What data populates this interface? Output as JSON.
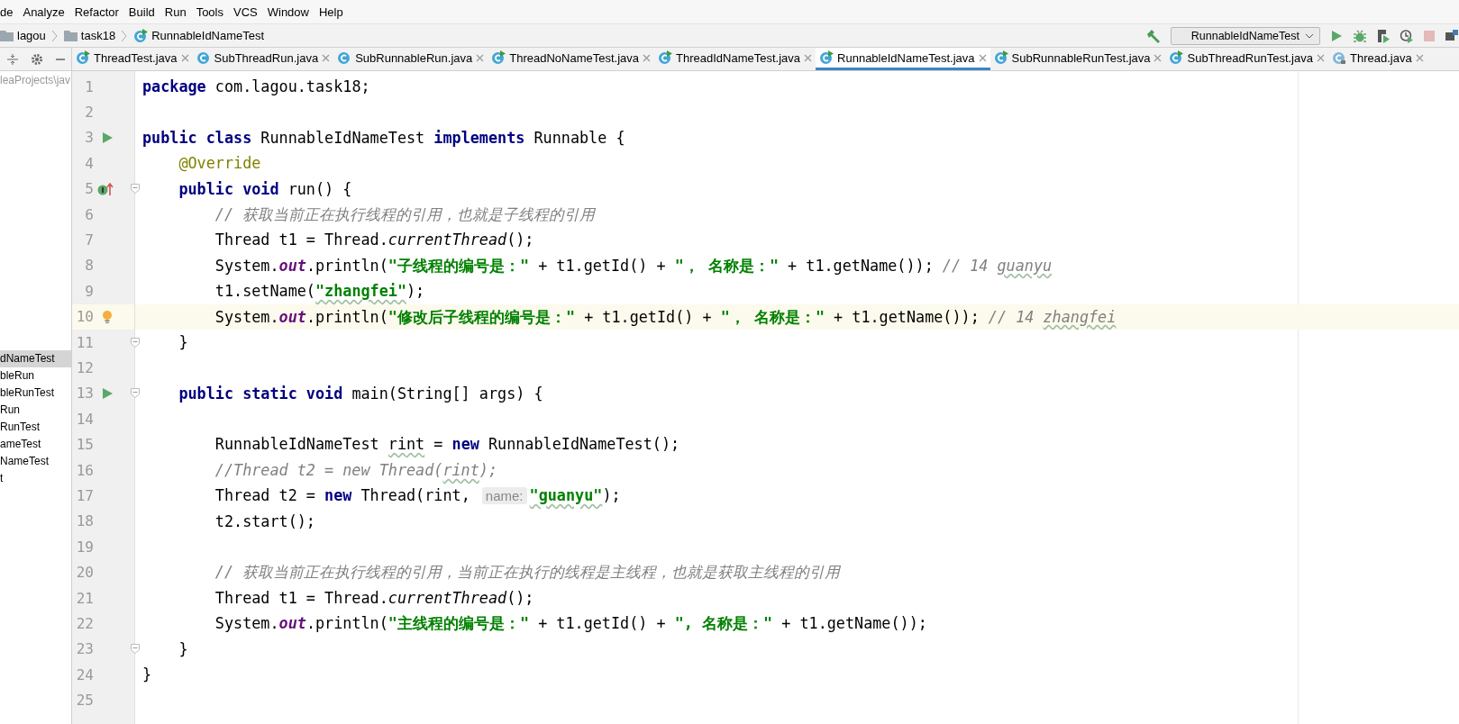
{
  "menu": [
    "de",
    "Analyze",
    "Refactor",
    "Build",
    "Run",
    "Tools",
    "VCS",
    "Window",
    "Help"
  ],
  "breadcrumbs": [
    {
      "label": "lagou",
      "kind": "folder"
    },
    {
      "label": "task18",
      "kind": "folder"
    },
    {
      "label": "RunnableIdNameTest",
      "kind": "class"
    }
  ],
  "toolbar": {
    "run_config": "RunnableIdNameTest",
    "actions": [
      {
        "kind": "build",
        "disabled": false
      },
      {
        "kind": "run",
        "disabled": false
      },
      {
        "kind": "debug",
        "disabled": false
      },
      {
        "kind": "coverage",
        "disabled": false
      },
      {
        "kind": "profile",
        "disabled": false
      },
      {
        "kind": "stop",
        "disabled": true
      },
      {
        "kind": "structure",
        "disabled": false
      }
    ]
  },
  "tabs": [
    {
      "label": "ThreadTest.java",
      "kind": "runnable",
      "selected": false
    },
    {
      "label": "SubThreadRun.java",
      "kind": "class",
      "selected": false
    },
    {
      "label": "SubRunnableRun.java",
      "kind": "class",
      "selected": false
    },
    {
      "label": "ThreadNoNameTest.java",
      "kind": "runnable",
      "selected": false
    },
    {
      "label": "ThreadIdNameTest.java",
      "kind": "runnable",
      "selected": false
    },
    {
      "label": "RunnableIdNameTest.java",
      "kind": "runnable",
      "selected": true
    },
    {
      "label": "SubRunnableRunTest.java",
      "kind": "runnable",
      "selected": false
    },
    {
      "label": "SubThreadRunTest.java",
      "kind": "runnable",
      "selected": false
    },
    {
      "label": "Thread.java",
      "kind": "library",
      "selected": false
    }
  ],
  "project": {
    "path": "leaProjects\\jav",
    "items": [
      {
        "label": "dNameTest",
        "selected": true
      },
      {
        "label": "bleRun",
        "selected": false
      },
      {
        "label": "bleRunTest",
        "selected": false
      },
      {
        "label": "Run",
        "selected": false
      },
      {
        "label": "RunTest",
        "selected": false
      },
      {
        "label": "ameTest",
        "selected": false
      },
      {
        "label": "NameTest",
        "selected": false
      },
      {
        "label": "t",
        "selected": false
      }
    ]
  },
  "editor": {
    "lines": [
      {
        "number": "1",
        "current": false,
        "fold": false,
        "tokens": [
          {
            "kind": "kw",
            "t": "package"
          },
          {
            "kind": "id",
            "t": " com.lagou.task18;"
          }
        ]
      },
      {
        "number": "2",
        "current": false,
        "fold": false
      },
      {
        "number": "3",
        "current": false,
        "fold": false,
        "marker": {
          "kind": "run"
        },
        "tokens": [
          {
            "kind": "kw",
            "t": "public class"
          },
          {
            "kind": "id",
            "t": " RunnableIdNameTest "
          },
          {
            "kind": "kw",
            "t": "implements"
          },
          {
            "kind": "id",
            "t": " Runnable {"
          }
        ]
      },
      {
        "number": "4",
        "current": false,
        "fold": false,
        "tokens": [
          {
            "kind": "ann",
            "t": "    @Override"
          }
        ]
      },
      {
        "number": "5",
        "current": false,
        "fold": true,
        "marker": {
          "kind": "implements"
        },
        "tokens": [
          {
            "kind": "kw",
            "t": "    public void"
          },
          {
            "kind": "id",
            "t": " run() {"
          }
        ]
      },
      {
        "number": "6",
        "current": false,
        "fold": false,
        "tokens": [
          {
            "kind": "cmt",
            "t": "        // 获取当前正在执行线程的引用，也就是子线程的引用"
          }
        ]
      },
      {
        "number": "7",
        "current": false,
        "fold": false,
        "tokens": [
          {
            "kind": "id",
            "t": "        Thread t1 = Thread."
          },
          {
            "kind": "smethod",
            "t": "currentThread"
          },
          {
            "kind": "id",
            "t": "();"
          }
        ]
      },
      {
        "number": "8",
        "current": false,
        "fold": false,
        "tokens": [
          {
            "kind": "id",
            "t": "        System."
          },
          {
            "kind": "sfield",
            "t": "out"
          },
          {
            "kind": "id",
            "t": ".println("
          },
          {
            "kind": "str",
            "t": "\"子线程的编号是：\""
          },
          {
            "kind": "id",
            "t": " + t1.getId() + "
          },
          {
            "kind": "str",
            "t": "\"， 名称是：\""
          },
          {
            "kind": "id",
            "t": " + t1.getName()); "
          },
          {
            "kind": "cmt",
            "t": "// 14 "
          },
          {
            "kind": "cmt",
            "t": "guanyu",
            "wavy": true
          }
        ]
      },
      {
        "number": "9",
        "current": false,
        "fold": false,
        "tokens": [
          {
            "kind": "id",
            "t": "        t1.setName("
          },
          {
            "kind": "str",
            "t": "\"zhangfei\"",
            "wavy": true
          },
          {
            "kind": "id",
            "t": ");"
          }
        ]
      },
      {
        "number": "10",
        "current": true,
        "fold": false,
        "marker": {
          "kind": "bulb"
        },
        "tokens": [
          {
            "kind": "id",
            "t": "        System."
          },
          {
            "kind": "sfield",
            "t": "out"
          },
          {
            "kind": "id",
            "t": ".println("
          },
          {
            "kind": "str",
            "t": "\"修改后子线程的编号是：\""
          },
          {
            "kind": "id",
            "t": " + t1.getId() + "
          },
          {
            "kind": "str",
            "t": "\"， 名称是：\""
          },
          {
            "kind": "id",
            "t": " + t1.getName()); "
          },
          {
            "kind": "cmt",
            "t": "// 14 "
          },
          {
            "kind": "cmt",
            "t": "zhangfei",
            "wavy": true
          }
        ]
      },
      {
        "number": "11",
        "current": false,
        "fold": true,
        "tokens": [
          {
            "kind": "id",
            "t": "    }"
          }
        ]
      },
      {
        "number": "12",
        "current": false,
        "fold": false
      },
      {
        "number": "13",
        "current": false,
        "fold": true,
        "marker": {
          "kind": "run"
        },
        "tokens": [
          {
            "kind": "kw",
            "t": "    public static void"
          },
          {
            "kind": "id",
            "t": " main(String[] args) {"
          }
        ]
      },
      {
        "number": "14",
        "current": false,
        "fold": false
      },
      {
        "number": "15",
        "current": false,
        "fold": false,
        "tokens": [
          {
            "kind": "id",
            "t": "        RunnableIdNameTest "
          },
          {
            "kind": "id",
            "t": "rint",
            "wavy": true
          },
          {
            "kind": "id",
            "t": " = "
          },
          {
            "kind": "kw",
            "t": "new"
          },
          {
            "kind": "id",
            "t": " RunnableIdNameTest();"
          }
        ]
      },
      {
        "number": "16",
        "current": false,
        "fold": false,
        "tokens": [
          {
            "kind": "cmt",
            "t": "        //Thread t2 = new Thread("
          },
          {
            "kind": "cmt",
            "t": "rint",
            "wavy": true
          },
          {
            "kind": "cmt",
            "t": ");"
          }
        ]
      },
      {
        "number": "17",
        "current": false,
        "fold": false,
        "tokens": [
          {
            "kind": "id",
            "t": "        Thread t2 = "
          },
          {
            "kind": "kw",
            "t": "new"
          },
          {
            "kind": "id",
            "t": " Thread(rint, "
          },
          {
            "kind": "hint",
            "t": "name:"
          },
          {
            "kind": "str",
            "t": "\"guanyu\"",
            "wavy": true
          },
          {
            "kind": "id",
            "t": ");"
          }
        ]
      },
      {
        "number": "18",
        "current": false,
        "fold": false,
        "tokens": [
          {
            "kind": "id",
            "t": "        t2.start();"
          }
        ]
      },
      {
        "number": "19",
        "current": false,
        "fold": false
      },
      {
        "number": "20",
        "current": false,
        "fold": false,
        "tokens": [
          {
            "kind": "cmt",
            "t": "        // 获取当前正在执行线程的引用，当前正在执行的线程是主线程，也就是获取主线程的引用"
          }
        ]
      },
      {
        "number": "21",
        "current": false,
        "fold": false,
        "tokens": [
          {
            "kind": "id",
            "t": "        Thread t1 = Thread."
          },
          {
            "kind": "smethod",
            "t": "currentThread"
          },
          {
            "kind": "id",
            "t": "();"
          }
        ]
      },
      {
        "number": "22",
        "current": false,
        "fold": false,
        "tokens": [
          {
            "kind": "id",
            "t": "        System."
          },
          {
            "kind": "sfield",
            "t": "out"
          },
          {
            "kind": "id",
            "t": ".println("
          },
          {
            "kind": "str",
            "t": "\"主线程的编号是：\""
          },
          {
            "kind": "id",
            "t": " + t1.getId() + "
          },
          {
            "kind": "str",
            "t": "\", 名称是：\""
          },
          {
            "kind": "id",
            "t": " + t1.getName());"
          }
        ]
      },
      {
        "number": "23",
        "current": false,
        "fold": true,
        "tokens": [
          {
            "kind": "id",
            "t": "    }"
          }
        ]
      },
      {
        "number": "24",
        "current": false,
        "fold": false,
        "tokens": [
          {
            "kind": "id",
            "t": "}"
          }
        ]
      },
      {
        "number": "25",
        "current": false,
        "fold": false
      }
    ]
  }
}
